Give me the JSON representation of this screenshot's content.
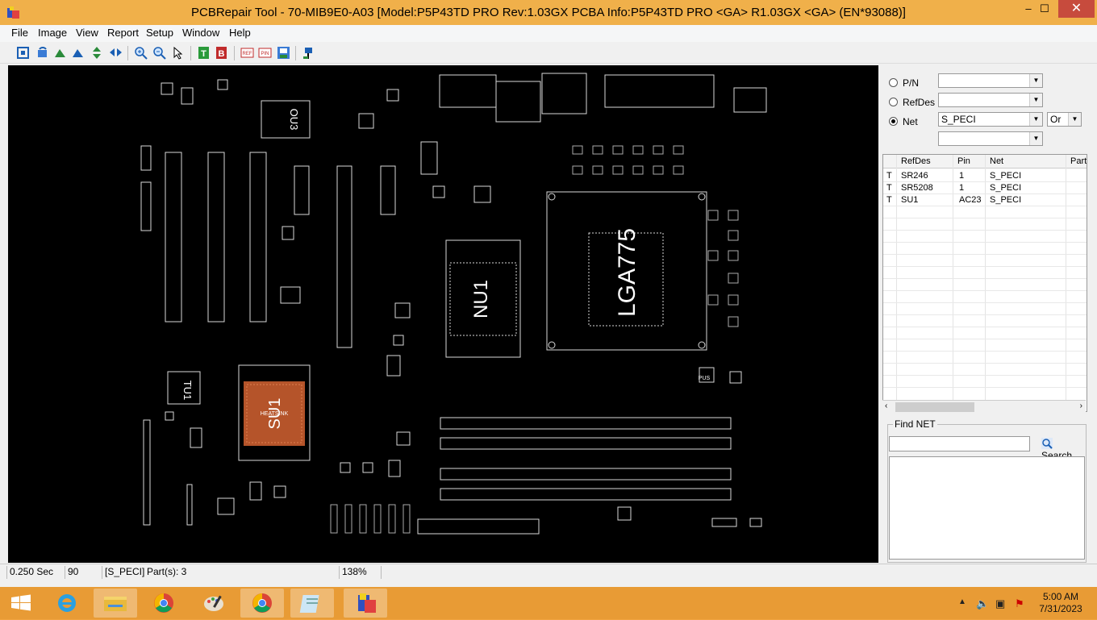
{
  "window": {
    "title": "PCBRepair Tool - 70-MIB9E0-A03 [Model:P5P43TD PRO Rev:1.03GX PCBA Info:P5P43TD PRO <GA> R1.03GX <GA> (EN*93088)]",
    "min_label": "–",
    "max_label": "☐",
    "close_label": "✕"
  },
  "menu": [
    "File",
    "Image",
    "View",
    "Report",
    "Setup",
    "Window",
    "Help"
  ],
  "board": {
    "cpu_socket": "LGA775",
    "north_bridge": "NU1",
    "south_bridge": "SU1",
    "heatsink_label": "HEATSINK",
    "chip_ou3": "OU3",
    "chip_tu1": "TU1",
    "chip_pus": "PUS"
  },
  "search": {
    "pn_label": "P/N",
    "refdes_label": "RefDes",
    "net_label": "Net",
    "pn_value": "",
    "refdes_value": "",
    "net_value": "S_PECI",
    "logic": "Or",
    "extra_value": "",
    "selected": "Net"
  },
  "results": {
    "columns": [
      "",
      "RefDes",
      "Pin",
      "Net",
      "Part"
    ],
    "rows": [
      {
        "side": "T",
        "refdes": "SR246",
        "pin": "1",
        "net": "S_PECI"
      },
      {
        "side": "T",
        "refdes": "SR5208",
        "pin": "1",
        "net": "S_PECI"
      },
      {
        "side": "T",
        "refdes": "SU1",
        "pin": "AC23",
        "net": "S_PECI"
      }
    ]
  },
  "findnet": {
    "label": "Find NET",
    "search_label": "Search",
    "input_value": ""
  },
  "status": {
    "time": "0.250 Sec",
    "angle": "90",
    "net": "[S_PECI]",
    "parts": "Part(s): 3",
    "zoom": "138%"
  },
  "clock": {
    "time": "5:00 AM",
    "date": "7/31/2023"
  },
  "taskbar": {
    "apps": [
      "windows-start",
      "internet-explorer",
      "file-explorer",
      "chrome",
      "paint",
      "chrome-2",
      "notepad",
      "pcbrepair-tool"
    ]
  }
}
